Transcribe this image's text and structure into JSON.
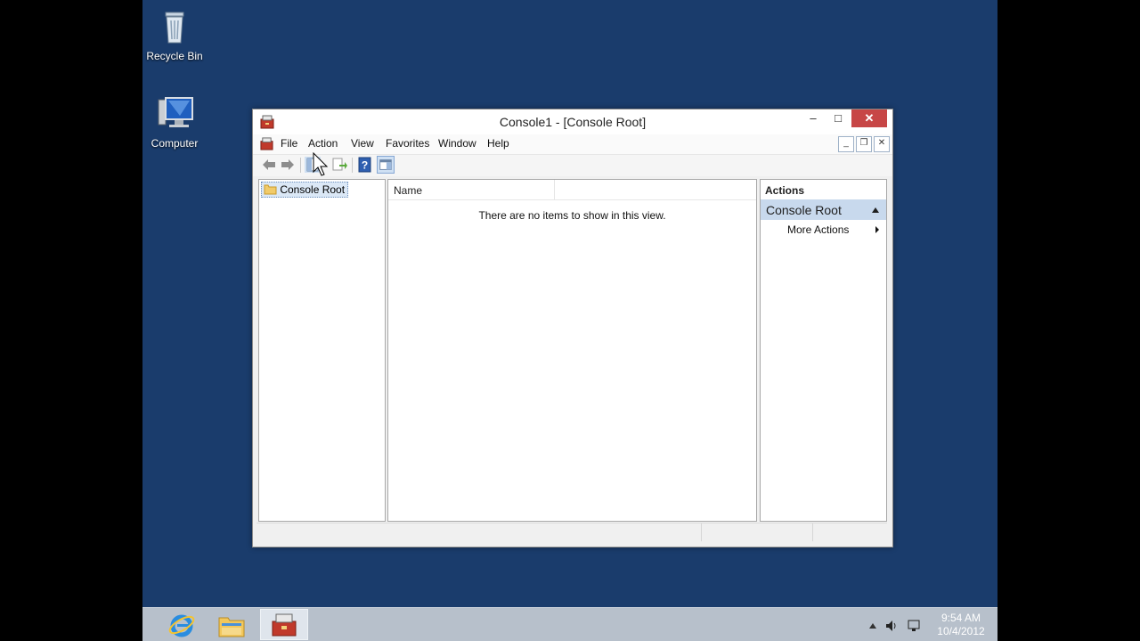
{
  "desktop": {
    "icons": [
      {
        "label": "Recycle Bin",
        "icon": "recycle-bin-icon"
      },
      {
        "label": "Computer",
        "icon": "computer-icon"
      }
    ]
  },
  "window": {
    "title": "Console1 - [Console Root]",
    "app_icon": "mmc-toolbox-icon",
    "controls": {
      "minimize": "–",
      "maximize": "□",
      "close": "✕"
    },
    "menu": [
      "File",
      "Action",
      "View",
      "Favorites",
      "Window",
      "Help"
    ],
    "mdi_controls": {
      "minimize": "_",
      "restore": "❐",
      "close": "✕"
    },
    "toolbar": [
      "back-arrow-icon",
      "forward-arrow-icon",
      "show-hide-tree-icon",
      "export-list-icon",
      "help-icon",
      "show-hide-action-pane-icon"
    ]
  },
  "tree": {
    "items": [
      {
        "label": "Console Root",
        "icon": "folder-icon"
      }
    ]
  },
  "list": {
    "columns": [
      "Name"
    ],
    "empty_message": "There are no items to show in this view."
  },
  "actions": {
    "header": "Actions",
    "section": "Console Root",
    "items": [
      "More Actions"
    ]
  },
  "taskbar": {
    "apps": [
      "internet-explorer-icon",
      "file-explorer-icon",
      "mmc-toolbox-icon"
    ],
    "tray": {
      "time": "9:54 AM",
      "date": "10/4/2012"
    }
  },
  "colors": {
    "desktop": "#1a3c6c",
    "close_button": "#c74646",
    "actions_section": "#c8d9ed",
    "taskbar": "#b7c0cb"
  }
}
